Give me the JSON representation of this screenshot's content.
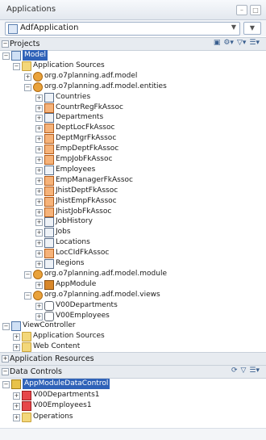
{
  "header": {
    "title": "Applications"
  },
  "application": {
    "name": "AdfApplication"
  },
  "projects_section": {
    "title": "Projects"
  },
  "tree": {
    "model": "Model",
    "application_sources": "Application Sources",
    "pkg_model": "org.o7planning.adf.model",
    "pkg_entities": "org.o7planning.adf.model.entities",
    "entities": [
      "Countries",
      "CountrRegFkAssoc",
      "Departments",
      "DeptLocFkAssoc",
      "DeptMgrFkAssoc",
      "EmpDeptFkAssoc",
      "EmpJobFkAssoc",
      "Employees",
      "EmpManagerFkAssoc",
      "JhistDeptFkAssoc",
      "JhistEmpFkAssoc",
      "JhistJobFkAssoc",
      "JobHistory",
      "Jobs",
      "Locations",
      "LocCIdFkAssoc",
      "Regions"
    ],
    "pkg_module": "org.o7planning.adf.model.module",
    "app_module": "AppModule",
    "pkg_views": "org.o7planning.adf.model.views",
    "views": [
      "V00Departments",
      "V00Employees"
    ],
    "view_controller": "ViewController",
    "vc_sources": "Application Sources",
    "vc_web": "Web Content"
  },
  "resources_section": {
    "title": "Application Resources"
  },
  "data_controls_section": {
    "title": "Data Controls"
  },
  "data_controls": {
    "root": "AppModuleDataControl",
    "items": [
      "V00Departments1",
      "V00Employees1",
      "Operations"
    ]
  }
}
